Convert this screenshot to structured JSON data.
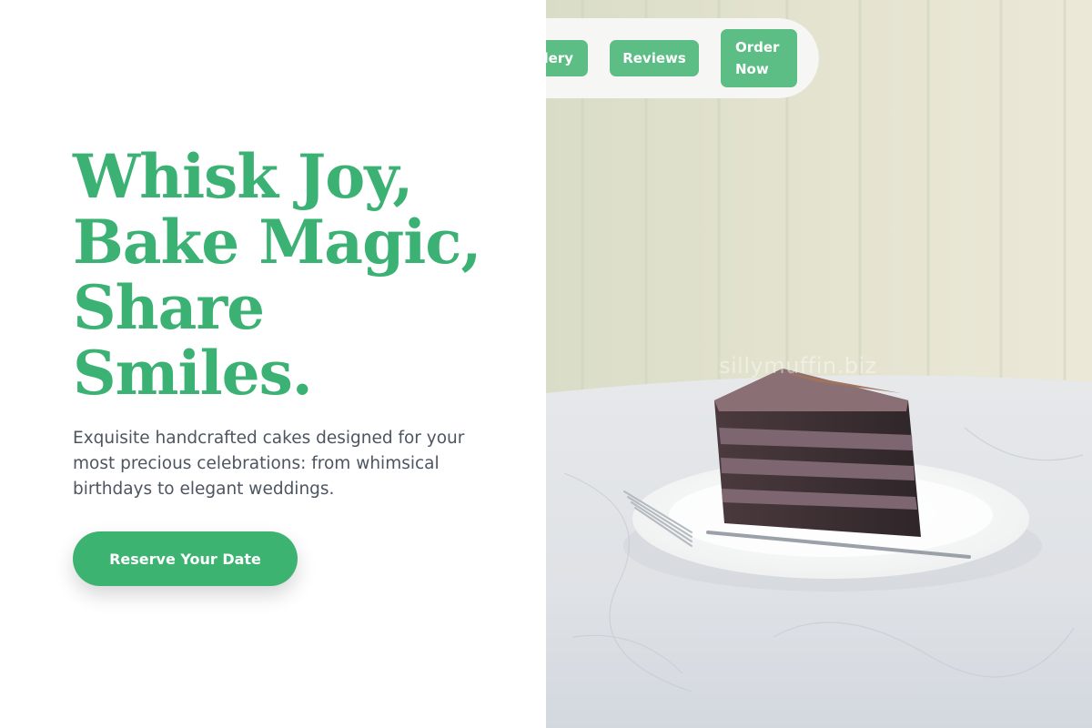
{
  "hero": {
    "headline_lines": [
      "Whisk Joy,",
      "Bake Magic,",
      "Share",
      "Smiles."
    ],
    "subtitle": "Exquisite handcrafted cakes designed for your most precious celebrations: from whimsical birthdays to elegant weddings.",
    "cta_label": "Reserve Your Date"
  },
  "nav": {
    "items": [
      {
        "label": "Gallery"
      },
      {
        "label": "Reviews"
      },
      {
        "label": "Order Now"
      }
    ]
  },
  "watermark": "sillymuffin.biz",
  "colors": {
    "brand_green": "#3cb371",
    "nav_button": "#5cbd85",
    "body_text": "#4d5561"
  }
}
